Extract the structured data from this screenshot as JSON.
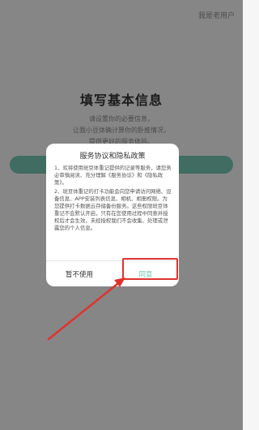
{
  "header": {
    "top_right_link": "我是老用户"
  },
  "main": {
    "title": "填写基本信息",
    "subtitle_lines": [
      "请设置你的必要信息，",
      "让我小豆体确计算你的卧推情况，",
      "提供更好的服务体验。"
    ]
  },
  "dialog": {
    "title": "服务协议和隐私政策",
    "paragraphs": [
      "1、欢将使用斑豆体重记提供的记录等服务，请您务必审慎阅读、充分理解《服务协议》和《隐私政策》。",
      "2、斑豆体重记的打卡功能会向您申请访问网络、设备信息、APP安装列表信息、相机、相册权限。为您提供打卡数据云存储备份服务。这些权限斑豆体重记不会默认开启，只有在您使用过程中同意并授权后才会生效，未经授权我们不会收集、处理或泄露您的个人信息。"
    ],
    "decline_label": "暂不使用",
    "agree_label": "同意"
  },
  "colors": {
    "accent": "#6cc5ae",
    "highlight": "#e0332e"
  }
}
